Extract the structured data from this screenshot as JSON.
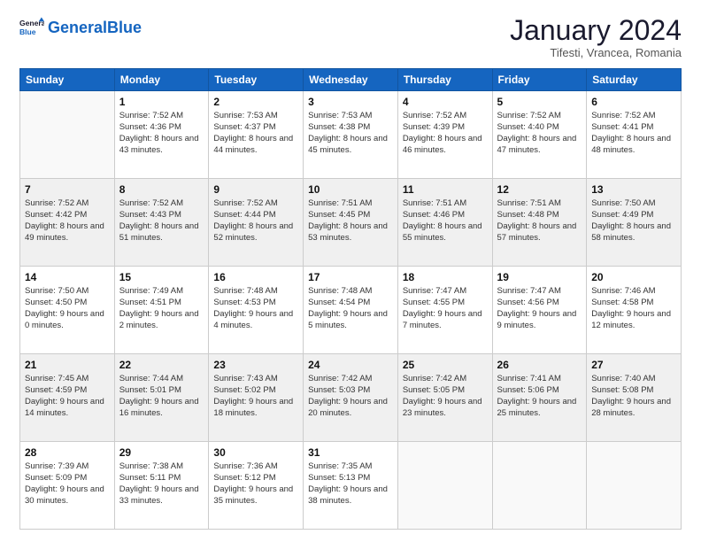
{
  "header": {
    "logo_general": "General",
    "logo_blue": "Blue",
    "month_title": "January 2024",
    "location": "Tifesti, Vrancea, Romania"
  },
  "days_of_week": [
    "Sunday",
    "Monday",
    "Tuesday",
    "Wednesday",
    "Thursday",
    "Friday",
    "Saturday"
  ],
  "weeks": [
    [
      {
        "day": "",
        "content": ""
      },
      {
        "day": "1",
        "sunrise": "7:52 AM",
        "sunset": "4:36 PM",
        "daylight": "8 hours and 43 minutes."
      },
      {
        "day": "2",
        "sunrise": "7:53 AM",
        "sunset": "4:37 PM",
        "daylight": "8 hours and 44 minutes."
      },
      {
        "day": "3",
        "sunrise": "7:53 AM",
        "sunset": "4:38 PM",
        "daylight": "8 hours and 45 minutes."
      },
      {
        "day": "4",
        "sunrise": "7:52 AM",
        "sunset": "4:39 PM",
        "daylight": "8 hours and 46 minutes."
      },
      {
        "day": "5",
        "sunrise": "7:52 AM",
        "sunset": "4:40 PM",
        "daylight": "8 hours and 47 minutes."
      },
      {
        "day": "6",
        "sunrise": "7:52 AM",
        "sunset": "4:41 PM",
        "daylight": "8 hours and 48 minutes."
      }
    ],
    [
      {
        "day": "7",
        "sunrise": "7:52 AM",
        "sunset": "4:42 PM",
        "daylight": "8 hours and 49 minutes."
      },
      {
        "day": "8",
        "sunrise": "7:52 AM",
        "sunset": "4:43 PM",
        "daylight": "8 hours and 51 minutes."
      },
      {
        "day": "9",
        "sunrise": "7:52 AM",
        "sunset": "4:44 PM",
        "daylight": "8 hours and 52 minutes."
      },
      {
        "day": "10",
        "sunrise": "7:51 AM",
        "sunset": "4:45 PM",
        "daylight": "8 hours and 53 minutes."
      },
      {
        "day": "11",
        "sunrise": "7:51 AM",
        "sunset": "4:46 PM",
        "daylight": "8 hours and 55 minutes."
      },
      {
        "day": "12",
        "sunrise": "7:51 AM",
        "sunset": "4:48 PM",
        "daylight": "8 hours and 57 minutes."
      },
      {
        "day": "13",
        "sunrise": "7:50 AM",
        "sunset": "4:49 PM",
        "daylight": "8 hours and 58 minutes."
      }
    ],
    [
      {
        "day": "14",
        "sunrise": "7:50 AM",
        "sunset": "4:50 PM",
        "daylight": "9 hours and 0 minutes."
      },
      {
        "day": "15",
        "sunrise": "7:49 AM",
        "sunset": "4:51 PM",
        "daylight": "9 hours and 2 minutes."
      },
      {
        "day": "16",
        "sunrise": "7:48 AM",
        "sunset": "4:53 PM",
        "daylight": "9 hours and 4 minutes."
      },
      {
        "day": "17",
        "sunrise": "7:48 AM",
        "sunset": "4:54 PM",
        "daylight": "9 hours and 5 minutes."
      },
      {
        "day": "18",
        "sunrise": "7:47 AM",
        "sunset": "4:55 PM",
        "daylight": "9 hours and 7 minutes."
      },
      {
        "day": "19",
        "sunrise": "7:47 AM",
        "sunset": "4:56 PM",
        "daylight": "9 hours and 9 minutes."
      },
      {
        "day": "20",
        "sunrise": "7:46 AM",
        "sunset": "4:58 PM",
        "daylight": "9 hours and 12 minutes."
      }
    ],
    [
      {
        "day": "21",
        "sunrise": "7:45 AM",
        "sunset": "4:59 PM",
        "daylight": "9 hours and 14 minutes."
      },
      {
        "day": "22",
        "sunrise": "7:44 AM",
        "sunset": "5:01 PM",
        "daylight": "9 hours and 16 minutes."
      },
      {
        "day": "23",
        "sunrise": "7:43 AM",
        "sunset": "5:02 PM",
        "daylight": "9 hours and 18 minutes."
      },
      {
        "day": "24",
        "sunrise": "7:42 AM",
        "sunset": "5:03 PM",
        "daylight": "9 hours and 20 minutes."
      },
      {
        "day": "25",
        "sunrise": "7:42 AM",
        "sunset": "5:05 PM",
        "daylight": "9 hours and 23 minutes."
      },
      {
        "day": "26",
        "sunrise": "7:41 AM",
        "sunset": "5:06 PM",
        "daylight": "9 hours and 25 minutes."
      },
      {
        "day": "27",
        "sunrise": "7:40 AM",
        "sunset": "5:08 PM",
        "daylight": "9 hours and 28 minutes."
      }
    ],
    [
      {
        "day": "28",
        "sunrise": "7:39 AM",
        "sunset": "5:09 PM",
        "daylight": "9 hours and 30 minutes."
      },
      {
        "day": "29",
        "sunrise": "7:38 AM",
        "sunset": "5:11 PM",
        "daylight": "9 hours and 33 minutes."
      },
      {
        "day": "30",
        "sunrise": "7:36 AM",
        "sunset": "5:12 PM",
        "daylight": "9 hours and 35 minutes."
      },
      {
        "day": "31",
        "sunrise": "7:35 AM",
        "sunset": "5:13 PM",
        "daylight": "9 hours and 38 minutes."
      },
      {
        "day": "",
        "content": ""
      },
      {
        "day": "",
        "content": ""
      },
      {
        "day": "",
        "content": ""
      }
    ]
  ],
  "labels": {
    "sunrise": "Sunrise:",
    "sunset": "Sunset:",
    "daylight": "Daylight:"
  }
}
